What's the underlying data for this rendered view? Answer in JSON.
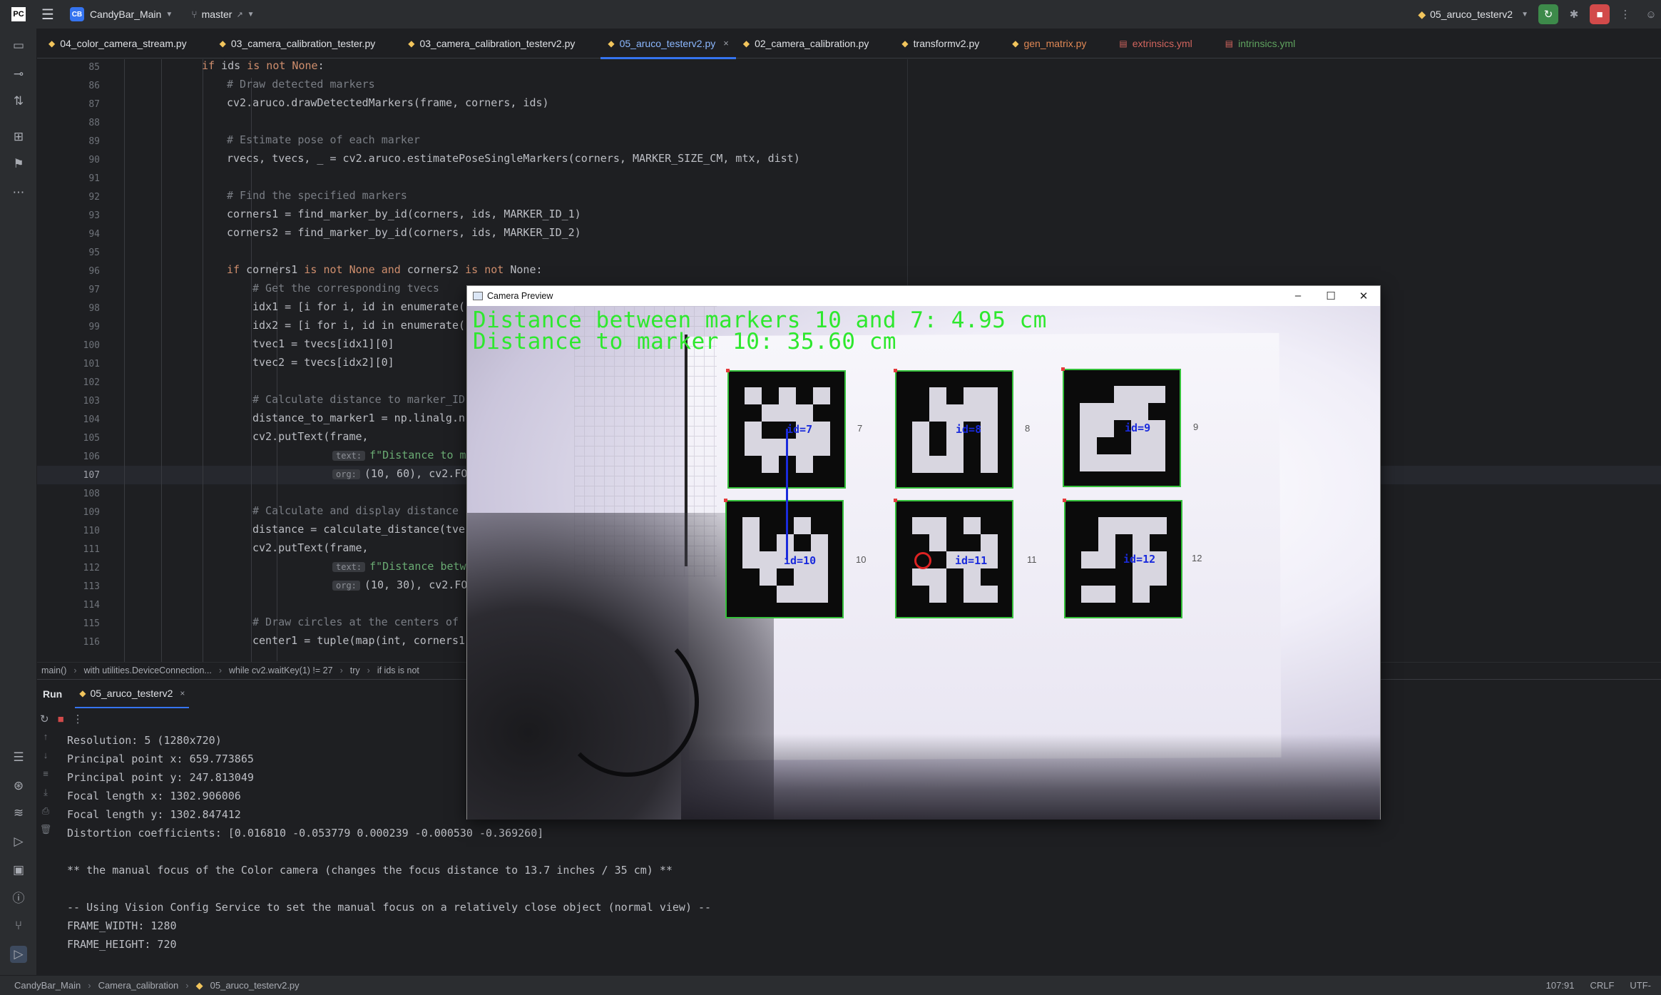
{
  "titlebar": {
    "project_badge": "CB",
    "project_name": "CandyBar_Main",
    "branch": "master",
    "run_config": "05_aruco_testerv2"
  },
  "tabs": [
    {
      "label": "04_color_camera_stream.py",
      "kind": "py",
      "active": false
    },
    {
      "label": "03_camera_calibration_tester.py",
      "kind": "py",
      "active": false
    },
    {
      "label": "03_camera_calibration_testerv2.py",
      "kind": "py",
      "active": false
    },
    {
      "label": "05_aruco_testerv2.py",
      "kind": "py",
      "active": true
    },
    {
      "label": "02_camera_calibration.py",
      "kind": "py",
      "active": false
    },
    {
      "label": "transformv2.py",
      "kind": "py",
      "active": false
    },
    {
      "label": "gen_matrix.py",
      "kind": "py",
      "active": false
    },
    {
      "label": "extrinsics.yml",
      "kind": "yml",
      "active": false
    },
    {
      "label": "intrinsics.yml",
      "kind": "yml",
      "active": false
    }
  ],
  "editor": {
    "line_numbers": [
      "85",
      "86",
      "87",
      "88",
      "89",
      "90",
      "91",
      "92",
      "93",
      "94",
      "95",
      "96",
      "97",
      "98",
      "99",
      "100",
      "101",
      "102",
      "103",
      "104",
      "105",
      "106",
      "107",
      "108",
      "109",
      "110",
      "111",
      "112",
      "113",
      "114",
      "115",
      "116"
    ],
    "current_line": "107",
    "lines": {
      "l85_kw1": "if",
      "l85_rest": " ids ",
      "l85_kw2": "is not",
      "l85_kw3": " None",
      "l85_end": ":",
      "l86": "# Draw detected markers",
      "l87": "cv2.aruco.drawDetectedMarkers(frame, corners, ids)",
      "l89": "# Estimate pose of each marker",
      "l90": "rvecs, tvecs, _ = cv2.aruco.estimatePoseSingleMarkers(corners, MARKER_SIZE_CM, mtx, dist)",
      "l92": "# Find the specified markers",
      "l93": "corners1 = find_marker_by_id(corners, ids, MARKER_ID_1)",
      "l94": "corners2 = find_marker_by_id(corners, ids, MARKER_ID_2)",
      "l96_kw1": "if",
      "l96_a": " corners1 ",
      "l96_kw2": "is not",
      "l96_b": " None ",
      "l96_kw3": "and",
      "l96_c": " corners2 ",
      "l96_kw4": "is not",
      "l96_d": " None:",
      "l97": "# Get the corresponding tvecs",
      "l98": "idx1 = [i for i, id in enumerate(",
      "l99": "idx2 = [i for i, id in enumerate(",
      "l100": "tvec1 = tvecs[idx1][0]",
      "l101": "tvec2 = tvecs[idx2][0]",
      "l103": "# Calculate distance to marker_ID",
      "l104": "distance_to_marker1 = np.linalg.n",
      "l105": "cv2.putText(frame,",
      "l106_hint": "text:",
      "l106": "f\"Distance to mar",
      "l107_hint": "org:",
      "l107": "(10, 60), cv2.FON",
      "l109": "# Calculate and display distance",
      "l110": "distance = calculate_distance(tve",
      "l111": "cv2.putText(frame,",
      "l112_hint": "text:",
      "l112": "f\"Distance betwe",
      "l113_hint": "org:",
      "l113": "(10, 30), cv2.FON",
      "l115": "# Draw circles at the centers of",
      "l116": "center1 = tuple(map(int, corners1"
    }
  },
  "breadcrumbs": [
    "main()",
    "with utilities.DeviceConnection...",
    "while cv2.waitKey(1) != 27",
    "try",
    "if ids is not"
  ],
  "run": {
    "title": "Run",
    "tab": "05_aruco_testerv2",
    "console": [
      "Resolution: 5 (1280x720)",
      "Principal point x: 659.773865",
      "Principal point y: 247.813049",
      "Focal length x: 1302.906006",
      "Focal length y: 1302.847412",
      "Distortion coefficients: [0.016810 -0.053779 0.000239 -0.000530 -0.369260]",
      "",
      "** the manual focus of the Color camera (changes the focus distance to 13.7 inches / 35 cm) **",
      "",
      "-- Using Vision Config Service to set the manual focus on a relatively close object (normal view) --",
      "FRAME_WIDTH: 1280",
      "FRAME_HEIGHT: 720"
    ]
  },
  "statusbar": {
    "crumbs": [
      "CandyBar_Main",
      "Camera_calibration",
      "05_aruco_testerv2.py"
    ],
    "position": "107:91",
    "line_ending": "CRLF",
    "encoding": "UTF-"
  },
  "camera": {
    "window_title": "Camera Preview",
    "overlay_line1": "Distance between markers 10 and 7: 4.95 cm",
    "overlay_line2": "Distance to marker 10: 35.60 cm",
    "markers": [
      {
        "id_text": "id=7",
        "label": "7"
      },
      {
        "id_text": "id=8",
        "label": "8"
      },
      {
        "id_text": "id=9",
        "label": "9"
      },
      {
        "id_text": "id=10",
        "label": "10"
      },
      {
        "id_text": "id=11",
        "label": "11"
      },
      {
        "id_text": "id=12",
        "label": "12"
      }
    ]
  },
  "colors": {
    "accent": "#3574f0",
    "overlay_text": "#2ee82e",
    "marker_id_text": "#1a2bdc",
    "keyword": "#cf8e6d",
    "comment": "#7a7e85"
  }
}
